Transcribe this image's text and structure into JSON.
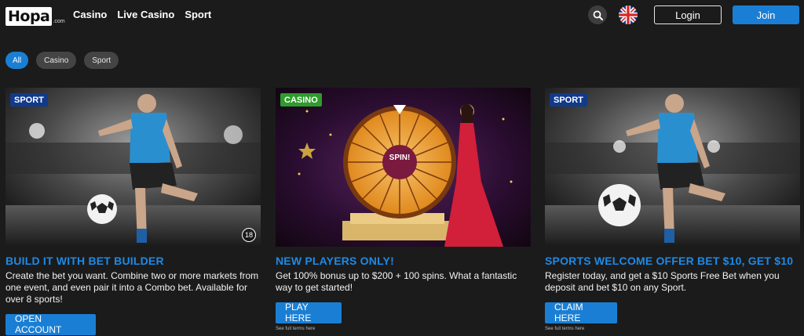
{
  "header": {
    "logo": "Hopa",
    "logo_suffix": ".com",
    "nav": [
      "Casino",
      "Live Casino",
      "Sport"
    ],
    "login": "Login",
    "join": "Join"
  },
  "icons": {
    "search": "search-icon",
    "flag": "uk-flag-icon"
  },
  "filters": [
    "All",
    "Casino",
    "Sport"
  ],
  "cards": [
    {
      "tag": "SPORT",
      "age": "18",
      "title": "BUILD IT WITH BET BUILDER",
      "body": "Create the bet you want. Combine two or more markets from one event, and even pair it into a Combo bet. Available for over 8 sports!",
      "cta": "OPEN ACCOUNT",
      "terms": ""
    },
    {
      "tag": "CASINO",
      "spin": "SPIN!",
      "title": "NEW PLAYERS ONLY!",
      "body": "Get 100% bonus up to $200 + 100 spins. What a fantastic way to get started!",
      "cta": "PLAY HERE",
      "terms": "See full terms here"
    },
    {
      "tag": "SPORT",
      "title": "SPORTS WELCOME OFFER BET $10, GET $10",
      "body": "Register today, and get a $10 Sports Free Bet when you deposit and bet $10 on any Sport.",
      "cta": "CLAIM HERE",
      "terms": "See full terms here"
    }
  ],
  "colors": {
    "accent": "#1a7fd4",
    "title": "#1e8ae6",
    "sport_tag": "#123a8a",
    "casino_tag": "#2e9b2c"
  }
}
